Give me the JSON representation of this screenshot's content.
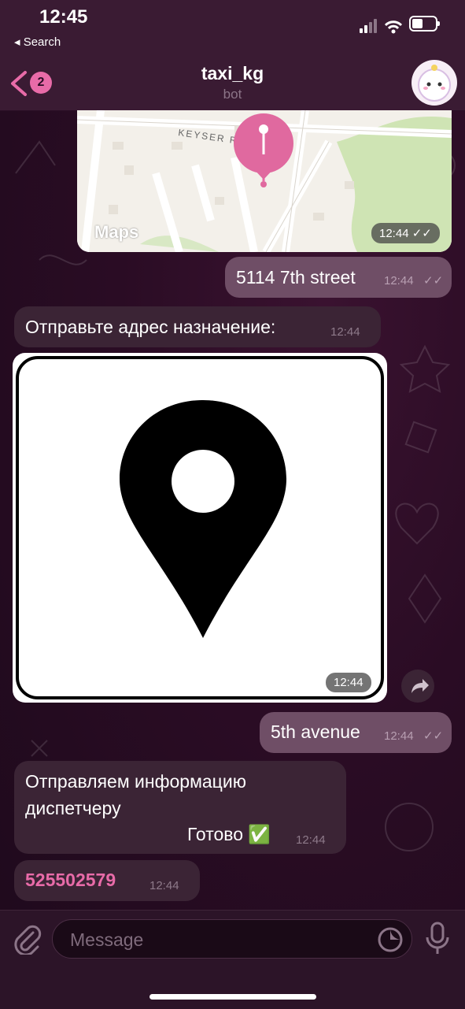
{
  "status_bar": {
    "time": "12:45",
    "back_app": "◂ Search",
    "battery_level": 0.45
  },
  "nav": {
    "back_badge": "2",
    "title": "taxi_kg",
    "subtitle": "bot"
  },
  "map": {
    "street_label": "KEYSER RD",
    "maps_brand": "Maps",
    "time": "12:44"
  },
  "messages": {
    "m1": {
      "text": "5114 7th street",
      "time": "12:44"
    },
    "m2": {
      "text": "Отправьте адрес назначение:",
      "time": "12:44"
    },
    "m3": {
      "time": "12:44"
    },
    "m4": {
      "text": "5th avenue",
      "time": "12:44"
    },
    "m5": {
      "line1": "Отправляем информацию",
      "line2": "диспетчеру",
      "line3": "Готово ✅",
      "time": "12:44"
    },
    "m6": {
      "text": "525502579",
      "time": "12:44"
    }
  },
  "composer": {
    "placeholder": "Message"
  },
  "colors": {
    "accent": "#e86ba8",
    "outgoing": "#6f4e66",
    "incoming": "#3b2435"
  }
}
